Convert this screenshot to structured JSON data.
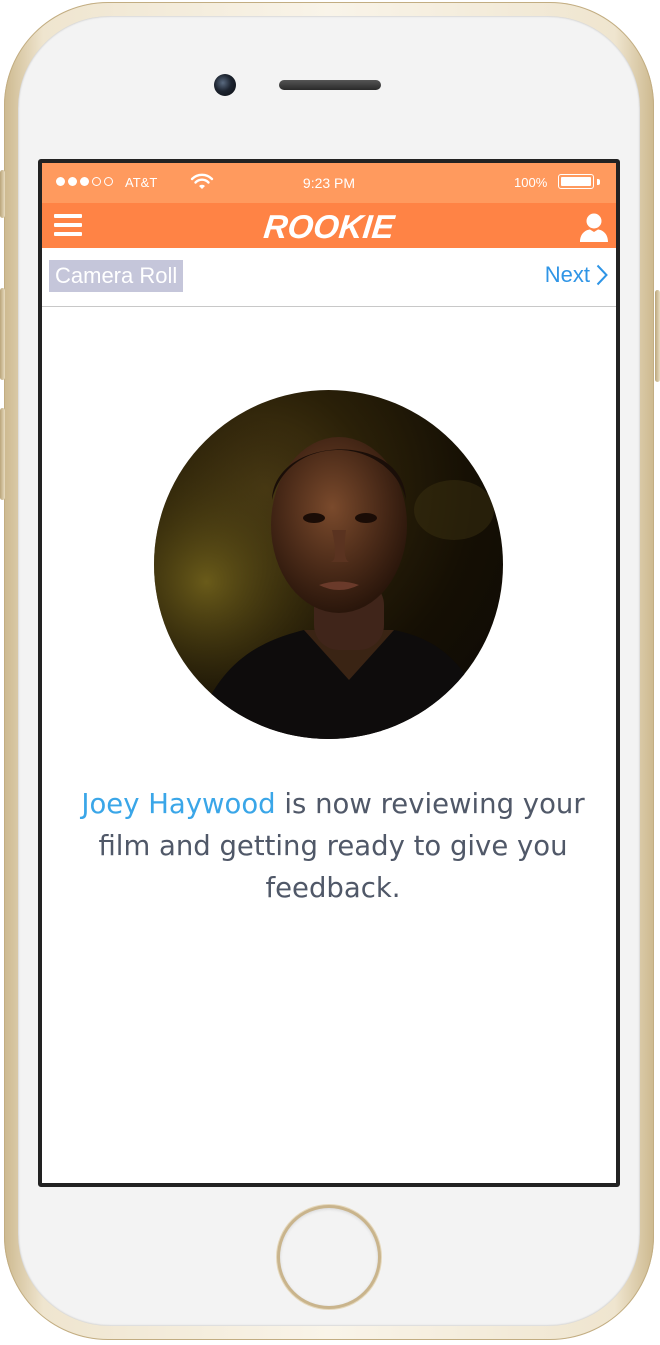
{
  "status_bar": {
    "carrier": "AT&T",
    "time": "9:23 PM",
    "battery_percent": "100%",
    "battery_level": 1.0,
    "signal_bars_filled": 3,
    "signal_bars_total": 5
  },
  "header": {
    "logo_text": "ROOKIE",
    "menu_icon": "hamburger-menu-icon",
    "profile_icon": "user-profile-icon",
    "background_color": "#ff8345"
  },
  "nav": {
    "back_label": "Camera Roll",
    "next_label": "Next",
    "next_icon": "chevron-right-icon"
  },
  "main": {
    "avatar_alt": "reviewer-photo",
    "reviewer_name": "Joey Haywood",
    "message_rest": " is now reviewing your film and getting ready to give you feedback."
  },
  "colors": {
    "accent": "#ff8345",
    "link": "#2f95e6",
    "name_highlight": "#3aa6e8"
  }
}
